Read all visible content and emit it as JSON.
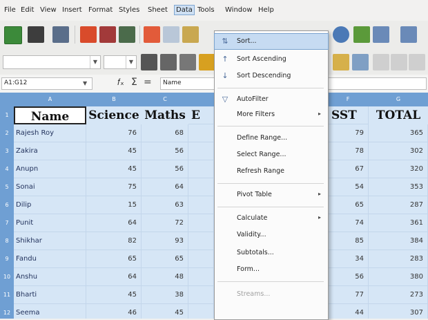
{
  "menubar": {
    "items": [
      "File",
      "Edit",
      "View",
      "Insert",
      "Format",
      "Styles",
      "Sheet",
      "Data",
      "Tools",
      "Window",
      "Help"
    ],
    "active": "Data"
  },
  "toolbar": {
    "font_name": "",
    "font_size": ""
  },
  "formula_bar": {
    "name_box": "A1:G12",
    "content": "Name"
  },
  "sheet": {
    "columns": [
      "A",
      "B",
      "C",
      "",
      "",
      "F",
      "G"
    ],
    "header_row": [
      "Name",
      "Science",
      "Maths",
      "E",
      "",
      "SST",
      "TOTAL"
    ],
    "rows": [
      {
        "n": "2",
        "name": "Rajesh Roy",
        "science": "76",
        "maths": "68",
        "sst": "79",
        "total": "365"
      },
      {
        "n": "3",
        "name": "Zakira",
        "science": "45",
        "maths": "56",
        "sst": "78",
        "total": "302"
      },
      {
        "n": "4",
        "name": "Anupn",
        "science": "45",
        "maths": "56",
        "sst": "67",
        "total": "320"
      },
      {
        "n": "5",
        "name": "Sonai",
        "science": "75",
        "maths": "64",
        "sst": "54",
        "total": "353"
      },
      {
        "n": "6",
        "name": "Dilip",
        "science": "15",
        "maths": "63",
        "sst": "65",
        "total": "287"
      },
      {
        "n": "7",
        "name": "Punit",
        "science": "64",
        "maths": "72",
        "sst": "74",
        "total": "361"
      },
      {
        "n": "8",
        "name": "Shikhar",
        "science": "82",
        "maths": "93",
        "sst": "85",
        "total": "384"
      },
      {
        "n": "9",
        "name": "Fandu",
        "science": "65",
        "maths": "65",
        "sst": "34",
        "total": "283"
      },
      {
        "n": "10",
        "name": "Anshu",
        "science": "64",
        "maths": "48",
        "sst": "56",
        "total": "380"
      },
      {
        "n": "11",
        "name": "Bharti",
        "science": "45",
        "maths": "38",
        "sst": "77",
        "total": "273"
      },
      {
        "n": "12",
        "name": "Seema",
        "science": "46",
        "maths": "45",
        "sst": "44",
        "total": "307"
      }
    ]
  },
  "data_menu": {
    "items": [
      {
        "label": "Sort...",
        "icon": "sort-icon",
        "highlighted": true
      },
      {
        "label": "Sort Ascending",
        "icon": "sort-ascending-icon"
      },
      {
        "label": "Sort Descending",
        "icon": "sort-descending-icon"
      },
      {
        "label": "AutoFilter",
        "icon": "autofilter-icon"
      },
      {
        "label": "More Filters",
        "submenu": true
      },
      {
        "label": "Define Range..."
      },
      {
        "label": "Select Range..."
      },
      {
        "label": "Refresh Range"
      },
      {
        "label": "Pivot Table",
        "submenu": true
      },
      {
        "label": "Calculate",
        "submenu": true
      },
      {
        "label": "Validity..."
      },
      {
        "label": "Subtotals..."
      },
      {
        "label": "Form..."
      },
      {
        "label": "Streams...",
        "disabled": true
      }
    ],
    "submenu_arrow": "▸"
  },
  "colors": {
    "selection_fill": "#d6e6f6",
    "header_blue": "#6f9fd3",
    "menu_highlight": "#c6dbf2"
  }
}
